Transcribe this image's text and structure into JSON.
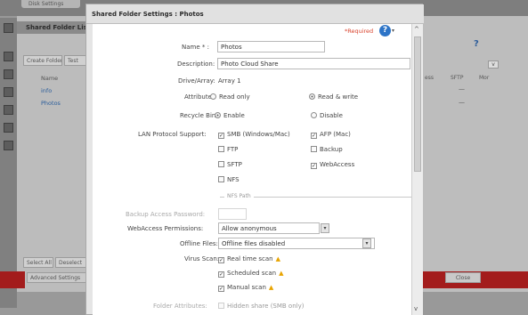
{
  "background": {
    "tab_label": "Disk Settings",
    "panel_title": "Shared Folder List",
    "create_folder_label": "Create Folder",
    "other_button_label": "Test",
    "column_name": "Name",
    "rows": [
      "info",
      "Photos"
    ],
    "column_access": "ess",
    "column_sftp": "SFTP",
    "column_more": "Mor",
    "select_all_label": "Select All",
    "deselect_label": "Deselect",
    "advanced_label": "Advanced Settings",
    "close_label": "Close"
  },
  "dialog": {
    "title": "Shared Folder Settings : Photos",
    "required_note": "*Required",
    "name": {
      "label": "Name * :",
      "value": "Photos"
    },
    "description": {
      "label": "Description:",
      "value": "Photo Cloud Share"
    },
    "drive": {
      "label": "Drive/Array:",
      "value": "Array 1"
    },
    "attribute": {
      "label": "Attribute:",
      "options": [
        "Read only",
        "Read & write"
      ],
      "selected": "Read & write"
    },
    "recycle_bin": {
      "label": "Recycle Bin:",
      "options": [
        "Enable",
        "Disable"
      ],
      "selected": "Enable"
    },
    "lan_protocol": {
      "label": "LAN Protocol Support:",
      "options": [
        {
          "label": "SMB (Windows/Mac)",
          "checked": true
        },
        {
          "label": "AFP (Mac)",
          "checked": true
        },
        {
          "label": "FTP",
          "checked": false
        },
        {
          "label": "Backup",
          "checked": false
        },
        {
          "label": "SFTP",
          "checked": false
        },
        {
          "label": "WebAccess",
          "checked": true
        },
        {
          "label": "NFS",
          "checked": false
        }
      ]
    },
    "nfs_path_label": "NFS Path",
    "backup_password_label": "Backup Access Password:",
    "webaccess": {
      "label": "WebAccess Permissions:",
      "value": "Allow anonymous"
    },
    "offline_files": {
      "label": "Offline Files:",
      "value": "Offline files disabled"
    },
    "virus_scan": {
      "label": "Virus Scan:",
      "options": [
        {
          "label": "Real time scan",
          "checked": true
        },
        {
          "label": "Scheduled scan",
          "checked": true
        },
        {
          "label": "Manual scan",
          "checked": true
        }
      ]
    },
    "folder_attributes": {
      "label": "Folder Attributes:",
      "option": "Hidden share (SMB only)"
    }
  }
}
